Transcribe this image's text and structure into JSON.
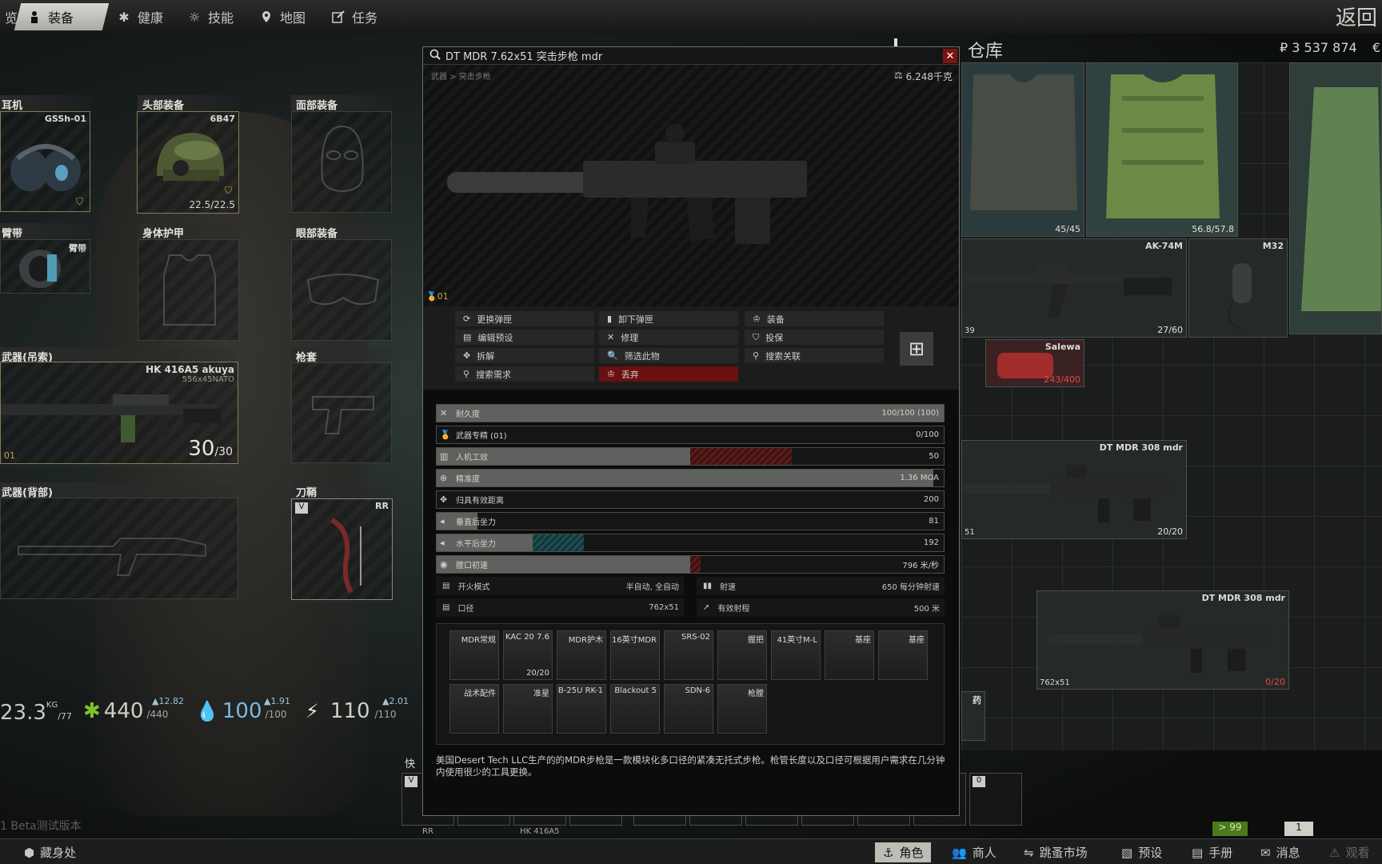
{
  "top_tabs": {
    "overview": "览",
    "gear": "装备",
    "health": "健康",
    "skills": "技能",
    "map": "地图",
    "tasks": "任务"
  },
  "back_label": "返回",
  "slots": {
    "earpiece": {
      "title": "耳机",
      "item": "GSSh-01"
    },
    "headwear": {
      "title": "头部装备",
      "item": "6B47",
      "durability": "22.5/22.5"
    },
    "facecover": {
      "title": "面部装备"
    },
    "armband": {
      "title": "臂带",
      "item": "臂带"
    },
    "body_armor": {
      "title": "身体护甲"
    },
    "eyewear": {
      "title": "眼部装备"
    },
    "primary": {
      "title": "武器(吊索)",
      "item": "HK 416A5 akuya",
      "caliber": "556x45NATO",
      "ammo": "30",
      "ammo_max": "/30",
      "mark": "01"
    },
    "holster": {
      "title": "枪套"
    },
    "back_weapon": {
      "title": "武器(背部)"
    },
    "scabbard": {
      "title": "刀鞘",
      "tag": "V",
      "item": "RR"
    }
  },
  "vitals": {
    "weight": "23.3",
    "weight_unit": "KG",
    "weight_max": "/77",
    "health": "440",
    "health_max": "/440",
    "health_delta": "12.82",
    "hydration": "100",
    "hydration_max": "/100",
    "hydration_delta": "1.91",
    "energy": "110",
    "energy_max": "/110",
    "energy_delta": "2.01"
  },
  "version_text": "1 Beta测试版本",
  "quickbar": {
    "label": "快",
    "slot1": "V",
    "slot1_name": "RR",
    "slot3_name": "HK 416A5",
    "slot_last": "0"
  },
  "stash": {
    "title": "仓库",
    "currency": "₽ 3 537 874",
    "items": [
      {
        "name": "",
        "count": "45/45"
      },
      {
        "name": "",
        "count": "56.8/57.8"
      },
      {
        "name": "AK-74M",
        "count": "27/60",
        "left": "39"
      },
      {
        "name": "M32",
        "count": ""
      },
      {
        "name": "Salewa",
        "count": "243/400"
      },
      {
        "name": "DT MDR 308 mdr",
        "count": "20/20",
        "left": "51"
      },
      {
        "name": "DT MDR 308 mdr",
        "count": "0/20",
        "caliber": "762x51"
      },
      {
        "name": "药",
        "count": ""
      }
    ]
  },
  "modal": {
    "title": "DT MDR 7.62x51 突击步枪 mdr",
    "breadcrumb": "武器 > 突击步枪",
    "weight": "6.248千克",
    "mark": "01",
    "actions": [
      "更换弹匣",
      "卸下弹匣",
      "装备",
      "编辑预设",
      "修理",
      "投保",
      "拆解",
      "筛选此物",
      "搜索关联",
      "搜索需求",
      "丢弃"
    ],
    "stats": [
      {
        "label": "耐久度",
        "value": "100/100 (100)",
        "fill": 1.0
      },
      {
        "label": "武器专精 (01)",
        "value": "0/100",
        "fill": 0.0
      },
      {
        "label": "人机工效",
        "value": "50",
        "fill": 0.5
      },
      {
        "label": "精准度",
        "value": "1.36 MOA",
        "fill": 0.98
      },
      {
        "label": "归具有效距离",
        "value": "200",
        "fill": 0.0
      },
      {
        "label": "垂直后坐力",
        "value": "81",
        "fill": 0.08
      },
      {
        "label": "水平后坐力",
        "value": "192",
        "fill": 0.19
      },
      {
        "label": "膛口初速",
        "value": "796 米/秒",
        "fill": 0.52
      }
    ],
    "pairs": [
      {
        "l_label": "开火模式",
        "l_value": "半自动, 全自动",
        "r_label": "射速",
        "r_value": "650 每分钟射速"
      },
      {
        "l_label": "口径",
        "l_value": "762x51",
        "r_label": "有效射程",
        "r_value": "500 米"
      }
    ],
    "mods": [
      {
        "name": "MDR常规",
        "count": ""
      },
      {
        "name": "KAC 20 7.6",
        "count": "20/20"
      },
      {
        "name": "MDR护木",
        "count": ""
      },
      {
        "name": "16英寸MDR",
        "count": ""
      },
      {
        "name": "SRS-02",
        "count": ""
      },
      {
        "name": "握把",
        "count": ""
      },
      {
        "name": "41英寸M-L",
        "count": ""
      },
      {
        "name": "基座",
        "count": ""
      },
      {
        "name": "基座",
        "count": ""
      },
      {
        "name": "战术配件",
        "count": ""
      },
      {
        "name": "准星",
        "count": ""
      },
      {
        "name": "B-25U RK-1",
        "count": ""
      },
      {
        "name": "Blackout 5",
        "count": ""
      },
      {
        "name": "SDN-6",
        "count": ""
      },
      {
        "name": "枪膛",
        "count": ""
      }
    ],
    "description": "美国Desert Tech LLC生产的的MDR步枪是一款模块化多口径的紧凑无托式步枪。枪管长度以及口径可根据用户需求在几分钟内使用很少的工具更换。"
  },
  "bottom_bar": {
    "hideout": "藏身处",
    "character": "角色",
    "traders": "商人",
    "flea": "跳蚤市场",
    "presets": "预设",
    "handbook": "手册",
    "messages": "消息",
    "watch": "观看",
    "badge1": "> 99",
    "badge2": "1"
  }
}
